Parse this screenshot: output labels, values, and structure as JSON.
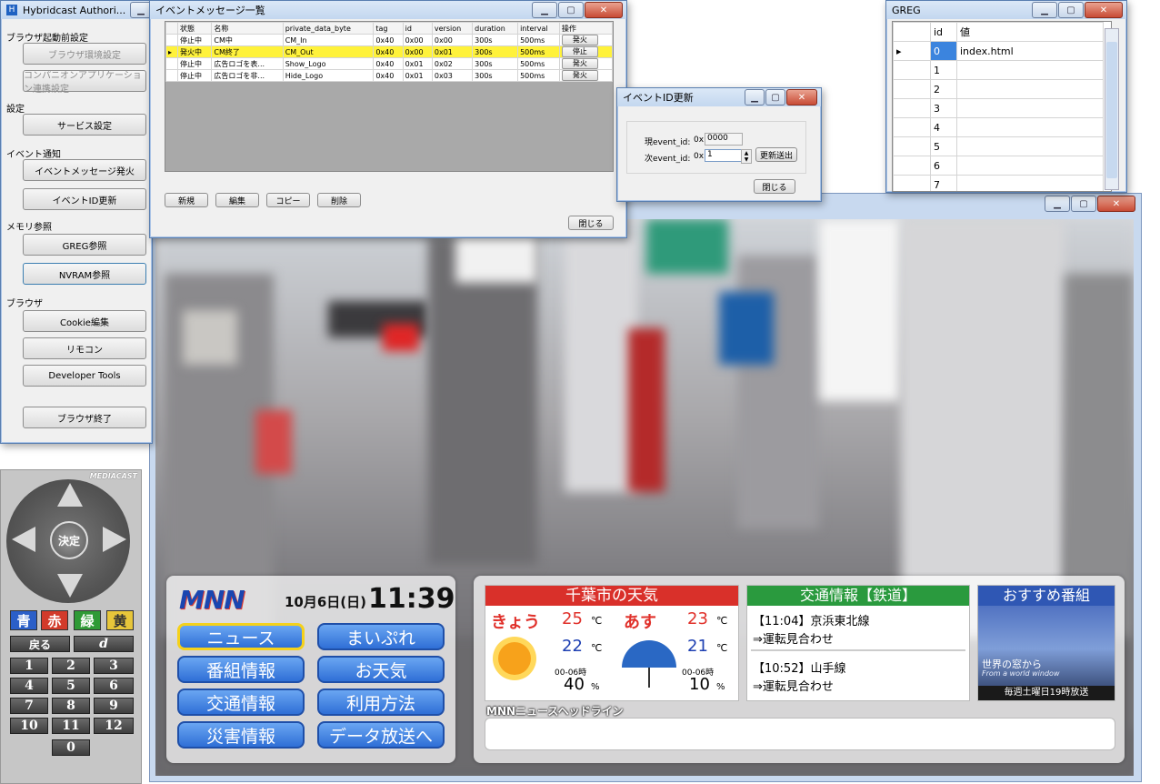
{
  "authoring": {
    "title": "Hybridcast Authori...",
    "groups": [
      {
        "label": "ブラウザ起動前設定",
        "buttons": [
          "ブラウザ環境設定",
          "コンパニオンアプリケーション連携設定"
        ]
      },
      {
        "label": "設定",
        "buttons": [
          "サービス設定"
        ]
      },
      {
        "label": "イベント通知",
        "buttons": [
          "イベントメッセージ発火",
          "イベントID更新"
        ]
      },
      {
        "label": "メモリ参照",
        "buttons": [
          "GREG参照",
          "NVRAM参照"
        ]
      },
      {
        "label": "ブラウザ",
        "buttons": [
          "Cookie編集",
          "リモコン",
          "Developer Tools"
        ]
      }
    ],
    "exit_button": "ブラウザ終了"
  },
  "event_list": {
    "title": "イベントメッセージ一覧",
    "columns": [
      "状態",
      "名称",
      "private_data_byte",
      "tag",
      "id",
      "version",
      "duration",
      "interval",
      "操作"
    ],
    "rows": [
      {
        "status": "停止中",
        "name": "CM中",
        "pdb": "CM_In",
        "tag": "0x40",
        "id": "0x00",
        "version": "0x00",
        "duration": "300s",
        "interval": "500ms",
        "action": "発火"
      },
      {
        "status": "発火中",
        "name": "CM終了",
        "pdb": "CM_Out",
        "tag": "0x40",
        "id": "0x00",
        "version": "0x01",
        "duration": "300s",
        "interval": "500ms",
        "action": "停止"
      },
      {
        "status": "停止中",
        "name": "広告ロゴを表...",
        "pdb": "Show_Logo",
        "tag": "0x40",
        "id": "0x01",
        "version": "0x02",
        "duration": "300s",
        "interval": "500ms",
        "action": "発火"
      },
      {
        "status": "停止中",
        "name": "広告ロゴを非...",
        "pdb": "Hide_Logo",
        "tag": "0x40",
        "id": "0x01",
        "version": "0x03",
        "duration": "300s",
        "interval": "500ms",
        "action": "発火"
      }
    ],
    "buttons": {
      "new": "新規",
      "edit": "編集",
      "copy": "コピー",
      "delete": "削除",
      "close": "閉じる"
    }
  },
  "event_id": {
    "title": "イベントID更新",
    "current_label": "現event_id:",
    "next_label": "次event_id:",
    "prefix": "0x",
    "current_value": "0000",
    "next_value": "1",
    "update_button": "更新送出",
    "close_button": "閉じる"
  },
  "greg": {
    "title": "GREG",
    "columns": [
      "id",
      "値"
    ],
    "rows": [
      {
        "id": "0",
        "value": "index.html"
      },
      {
        "id": "1",
        "value": ""
      },
      {
        "id": "2",
        "value": ""
      },
      {
        "id": "3",
        "value": ""
      },
      {
        "id": "4",
        "value": ""
      },
      {
        "id": "5",
        "value": ""
      },
      {
        "id": "6",
        "value": ""
      },
      {
        "id": "7",
        "value": ""
      }
    ]
  },
  "remote": {
    "brand": "MEDIACAST",
    "ok": "決定",
    "colors": [
      {
        "label": "青",
        "hex": "#2b5fc8"
      },
      {
        "label": "赤",
        "hex": "#d23a2a"
      },
      {
        "label": "緑",
        "hex": "#2f9a36"
      },
      {
        "label": "黄",
        "hex": "#e7c63a"
      }
    ],
    "back": "戻る",
    "d": "d",
    "digits": [
      "1",
      "2",
      "3",
      "4",
      "5",
      "6",
      "7",
      "8",
      "9",
      "10",
      "11",
      "12",
      "0"
    ]
  },
  "tv": {
    "logo": "MNN",
    "date": "10月6日(日)",
    "time": "11:39",
    "menu": [
      "ニュース",
      "まいぷれ",
      "番組情報",
      "お天気",
      "交通情報",
      "利用方法",
      "災害情報",
      "データ放送へ"
    ],
    "weather": {
      "title": "千葉市の天気",
      "today": "きょう",
      "tomorrow": "あす",
      "today_high": "25",
      "today_low": "22",
      "tomorrow_high": "23",
      "tomorrow_low": "21",
      "period": "00-06時",
      "today_rain": "40",
      "tomorrow_rain": "10",
      "pct": "%",
      "deg": "℃"
    },
    "traffic": {
      "title": "交通情報【鉄道】",
      "items": [
        {
          "time": "【11:04】京浜東北線",
          "status": "⇒運転見合わせ"
        },
        {
          "time": "【10:52】山手線",
          "status": "⇒運転見合わせ"
        }
      ]
    },
    "recommend": {
      "title": "おすすめ番組",
      "show": "世界の窓から",
      "show_en": "From a world window",
      "schedule": "毎週土曜日19時放送"
    },
    "headline": "MNNニュースヘッドライン"
  }
}
